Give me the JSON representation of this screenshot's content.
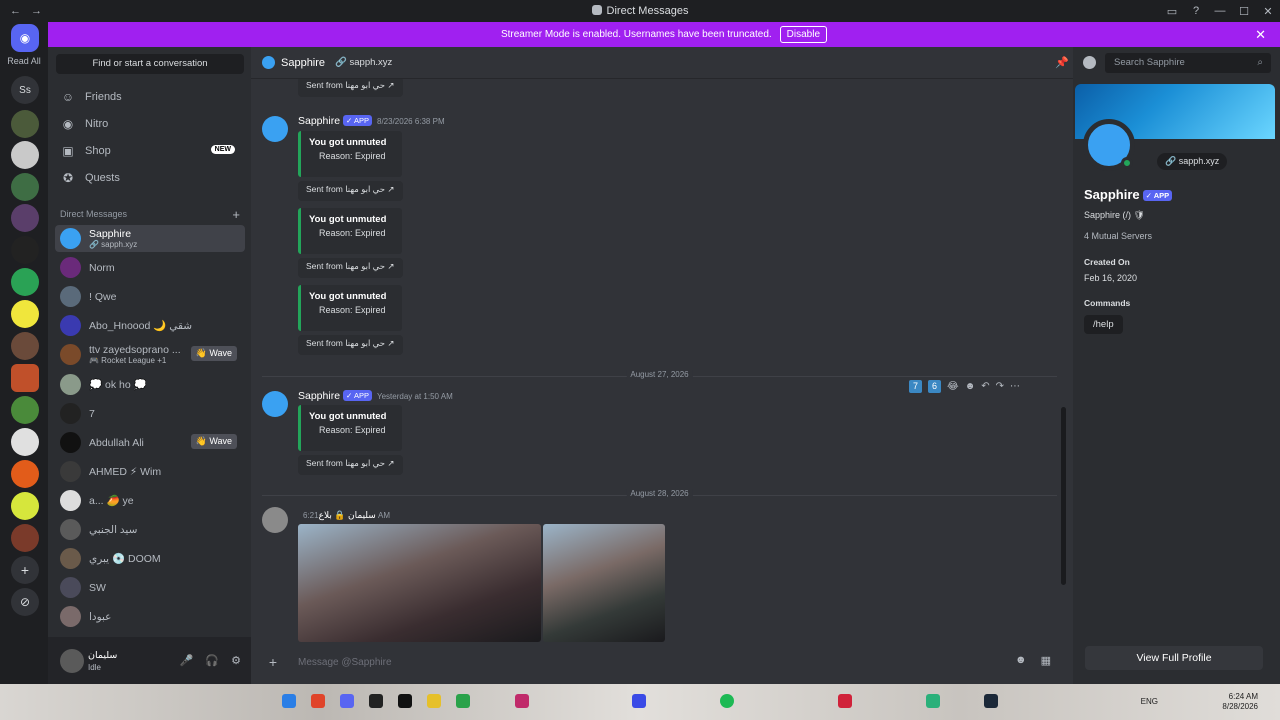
{
  "window": {
    "title": "Direct Messages",
    "nav_back": "←",
    "nav_forward": "→",
    "controls": [
      "▭",
      "?",
      "—",
      "☐",
      "✕"
    ]
  },
  "banner": {
    "text": "Streamer Mode is enabled. Usernames have been truncated.",
    "button": "Disable",
    "close": "✕"
  },
  "servers": {
    "read_all": "Read All",
    "ss_label": "Ss",
    "add": "+",
    "explore": "⊘"
  },
  "sidebar": {
    "find": "Find or start a conversation",
    "nav": [
      {
        "label": "Friends",
        "icon": "friends-icon",
        "glyph": "☺"
      },
      {
        "label": "Nitro",
        "icon": "nitro-icon",
        "glyph": "◉"
      },
      {
        "label": "Shop",
        "icon": "shop-icon",
        "glyph": "▣"
      },
      {
        "label": "Quests",
        "icon": "quests-icon",
        "glyph": "✪"
      }
    ],
    "shop_badge": "NEW",
    "dm_header": "Direct Messages",
    "dm_add": "+",
    "dms": [
      {
        "name": "Sapphire",
        "sub": "🔗 sapph.xyz"
      },
      {
        "name": "Norm"
      },
      {
        "name": "! Qwe"
      },
      {
        "name": "Abo_Hnoood 🌙 شقي"
      },
      {
        "name": "ttv zayedsoprano ...",
        "sub": "🎮 Rocket League +1",
        "wave": "👋 Wave"
      },
      {
        "name": "💭 ok ho 💭"
      },
      {
        "name": "7"
      },
      {
        "name": "Abdullah Ali",
        "wave": "👋 Wave"
      },
      {
        "name": "AHMED ⚡ Wim"
      },
      {
        "name": "a... 🥭 ye"
      },
      {
        "name": "سيد الجنبي"
      },
      {
        "name": "يبري 💿 DOOM"
      },
      {
        "name": "SW"
      },
      {
        "name": "عبودا"
      }
    ],
    "user": {
      "name": "سليمان",
      "status": "Idle"
    },
    "user_controls": [
      "🎤",
      "🎧",
      "⚙"
    ]
  },
  "chat": {
    "header": {
      "name": "Sapphire",
      "link": "🔗 sapph.xyz",
      "pin": "📌"
    },
    "sent_from": "Sent from حي ابو مهنا ↗",
    "embed_title": "You got unmuted",
    "embed_reason": "Reason: Expired",
    "bot_name": "Sapphire",
    "app_tag": "✓ APP",
    "msg1_time": "8/23/2026 6:38 PM",
    "msg2_time": "Yesterday at 1:50 AM",
    "date1": "August 27, 2026",
    "date2": "August 28, 2026",
    "user_name": "سليمان 🔒 بلاع",
    "user_time": "6:21 AM",
    "hover_bar": {
      "k1": "7",
      "k2": "6",
      "e1": "😂",
      "e2": "☻",
      "reply": "↶",
      "forward": "↷",
      "more": "⋯"
    },
    "composer_placeholder": "Message @Sapphire",
    "composer_plus": "+",
    "composer_icons": [
      "☻",
      "▦"
    ]
  },
  "profile": {
    "search_placeholder": "Search Sapphire",
    "link": "🔗 sapph.xyz",
    "name": "Sapphire",
    "app_tag": "✓ APP",
    "username": "Sapphire (/) 🛡",
    "mutual": "4 Mutual Servers",
    "created_label": "Created On",
    "created_value": "Feb 16, 2020",
    "commands_label": "Commands",
    "command": "/help",
    "view_full": "View Full Profile"
  },
  "taskbar": {
    "lang": "ENG",
    "time": "6:24 AM",
    "date": "8/28/2026"
  }
}
